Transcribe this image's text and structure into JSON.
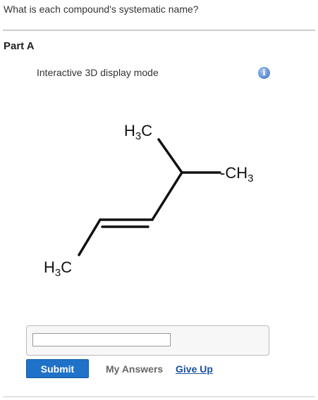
{
  "question": "What is each compound's systematic name?",
  "part": {
    "title": "Part A"
  },
  "display": {
    "mode_label": "Interactive 3D display mode",
    "info_icon": "info-icon"
  },
  "molecule": {
    "label_h3c_top": {
      "main": "H",
      "sub": "3",
      "tail": "C"
    },
    "label_ch3_right": {
      "main": "-CH",
      "sub": "3"
    },
    "label_h3c_bottom": {
      "main": "H",
      "sub": "3",
      "tail": "C"
    }
  },
  "answer": {
    "value": "",
    "placeholder": ""
  },
  "actions": {
    "submit_label": "Submit",
    "my_answers_label": "My Answers",
    "give_up_label": "Give Up"
  },
  "colors": {
    "primary_button": "#1f72c7",
    "link": "#1a4fa0",
    "rule": "#cccccc"
  }
}
